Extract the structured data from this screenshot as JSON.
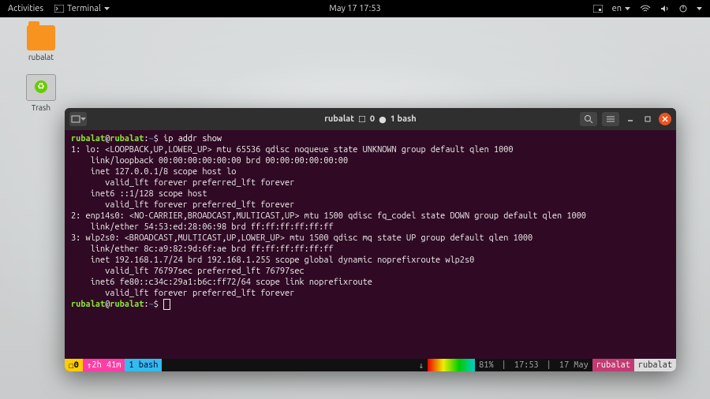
{
  "panel": {
    "activities": "Activities",
    "app": "Terminal",
    "datetime": "May 17  17:53",
    "lang": "en"
  },
  "desktop": {
    "folder_label": "rubalat",
    "trash_label": "Trash"
  },
  "titlebar": {
    "title": "rubalat",
    "tab_count": "0",
    "session": "1 bash"
  },
  "prompt": {
    "user": "rubalat",
    "host": "rubalat",
    "path": "~",
    "sep": "$",
    "command": "ip addr show"
  },
  "output": [
    "1: lo: <LOOPBACK,UP,LOWER_UP> mtu 65536 qdisc noqueue state UNKNOWN group default qlen 1000",
    "    link/loopback 00:00:00:00:00:00 brd 00:00:00:00:00:00",
    "    inet 127.0.0.1/8 scope host lo",
    "       valid_lft forever preferred_lft forever",
    "    inet6 ::1/128 scope host",
    "       valid_lft forever preferred_lft forever",
    "2: enp14s0: <NO-CARRIER,BROADCAST,MULTICAST,UP> mtu 1500 qdisc fq_codel state DOWN group default qlen 1000",
    "    link/ether 54:53:ed:28:06:98 brd ff:ff:ff:ff:ff:ff",
    "3: wlp2s0: <BROADCAST,MULTICAST,UP,LOWER_UP> mtu 1500 qdisc mq state UP group default qlen 1000",
    "    link/ether 8c:a9:82:9d:6f:ae brd ff:ff:ff:ff:ff:ff",
    "    inet 192.168.1.7/24 brd 192.168.1.255 scope global dynamic noprefixroute wlp2s0",
    "       valid_lft 76797sec preferred_lft 76797sec",
    "    inet6 fe80::c34c:29a1:b6c:ff72/64 scope link noprefixroute",
    "       valid_lft forever preferred_lft forever"
  ],
  "status": {
    "win": "0",
    "uptime": "2h 41m",
    "session": "1 bash",
    "load_pct": "81%",
    "time": "17:53",
    "date": "17 May",
    "user": "rubalat",
    "host": "rubalat"
  }
}
